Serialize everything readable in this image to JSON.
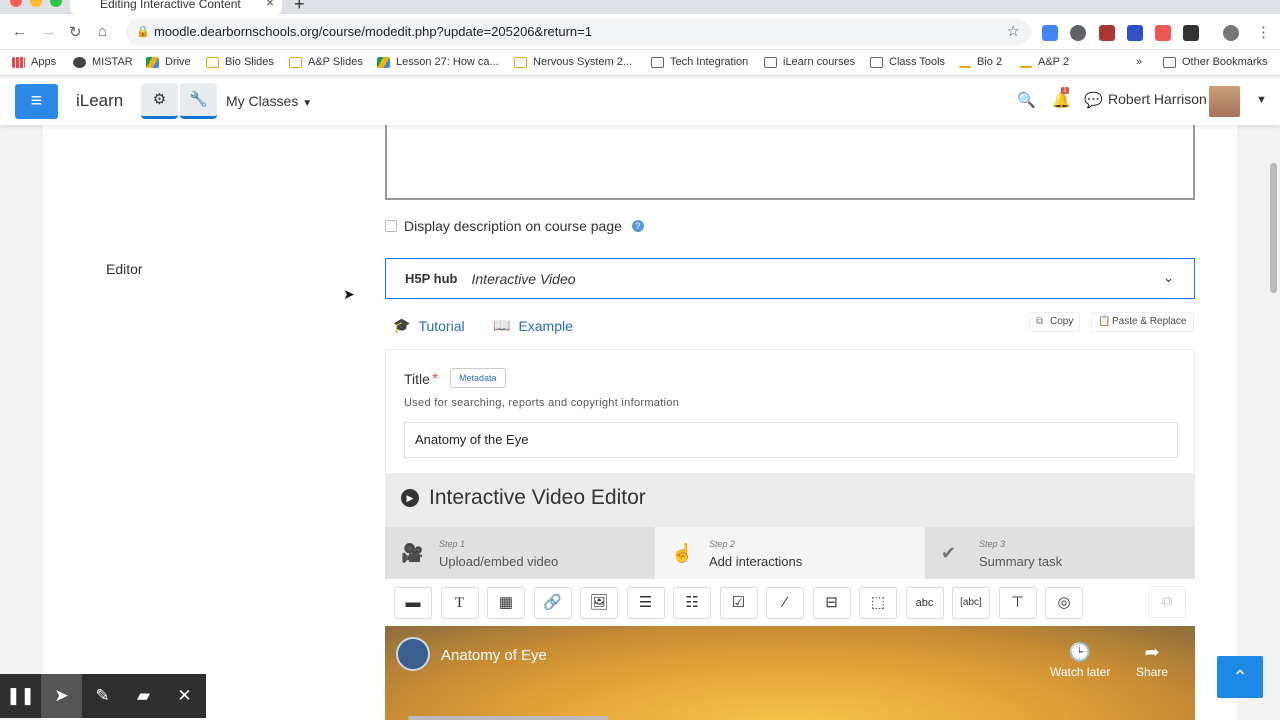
{
  "browser": {
    "tab_title": "Editing Interactive Content",
    "url": "moodle.dearbornschools.org/course/modedit.php?update=205206&return=1",
    "bookmarks": [
      {
        "label": "Apps",
        "icon": "apps-grid-icon"
      },
      {
        "label": "MISTAR",
        "icon": "globe-icon"
      },
      {
        "label": "Drive",
        "icon": "google-drive-icon"
      },
      {
        "label": "Bio Slides",
        "icon": "slides-folder-icon"
      },
      {
        "label": "A&P Slides",
        "icon": "slides-folder-icon"
      },
      {
        "label": "Lesson 27: How ca...",
        "icon": "google-drive-icon"
      },
      {
        "label": "Nervous System 2...",
        "icon": "slides-folder-icon"
      },
      {
        "label": "Tech Integration",
        "icon": "folder-icon"
      },
      {
        "label": "iLearn courses",
        "icon": "folder-icon"
      },
      {
        "label": "Class Tools",
        "icon": "folder-icon"
      },
      {
        "label": "Bio 2",
        "icon": "ilearn-icon"
      },
      {
        "label": "A&P 2",
        "icon": "ilearn-icon"
      }
    ],
    "more_bookmarks": "»",
    "other_bookmarks": "Other Bookmarks"
  },
  "navbar": {
    "brand": "iLearn",
    "my_classes": "My Classes",
    "user_name": "Robert Harrison",
    "notification_count": "1"
  },
  "form": {
    "display_description_label": "Display description on course page",
    "editor_label": "Editor",
    "hub_logo": "H5P hub",
    "content_type": "Interactive Video",
    "tutorial_label": "Tutorial",
    "example_label": "Example",
    "copy_label": "Copy",
    "paste_label": "Paste & Replace",
    "title_label": "Title",
    "required_mark": "*",
    "metadata_label": "Metadata",
    "title_help": "Used for searching, reports and copyright information",
    "title_value": "Anatomy of the Eye"
  },
  "ive": {
    "heading": "Interactive Video Editor",
    "steps": [
      {
        "num": "Step 1",
        "label": "Upload/embed video"
      },
      {
        "num": "Step 2",
        "label": "Add interactions"
      },
      {
        "num": "Step 3",
        "label": "Summary task"
      }
    ],
    "video_title": "Anatomy of Eye",
    "watch_later": "Watch later",
    "share": "Share"
  }
}
